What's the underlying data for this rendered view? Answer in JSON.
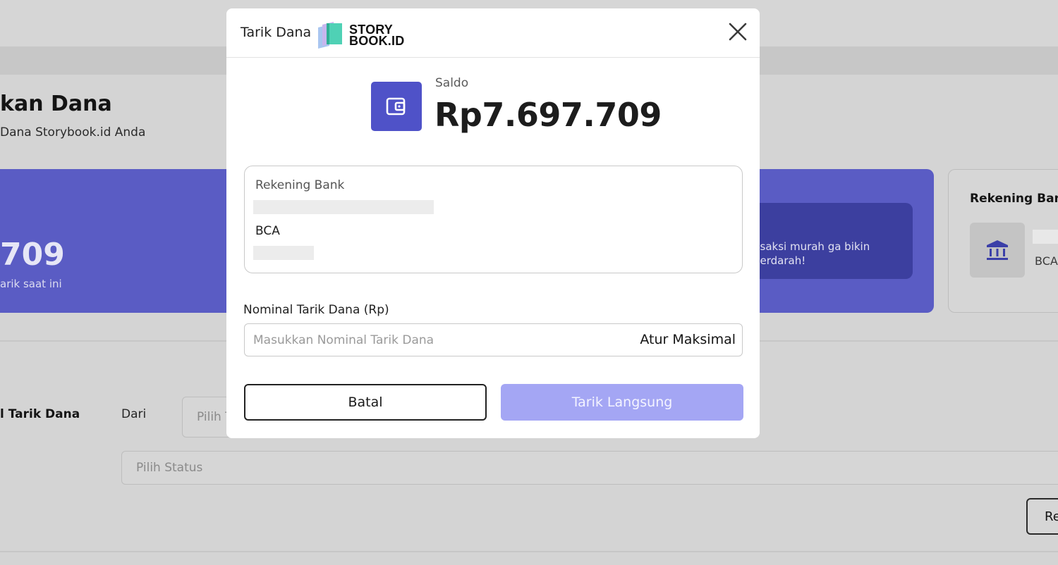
{
  "background": {
    "page_title": "kan Dana",
    "page_subtitle": "Dana Storybook.id Anda",
    "balance_card": {
      "amount": "709",
      "caption": "arik saat ini"
    },
    "promo_card": {
      "text": "nsaksi murah ga bikin berdarah!"
    },
    "bank_card": {
      "title": "Rekening Bank",
      "bank_name": "BCA"
    },
    "filter": {
      "label": "l Tarik Dana",
      "from_label": "Dari",
      "date_placeholder": "Pilih T",
      "status_placeholder": "Pilih Status",
      "reset_label": "Re"
    }
  },
  "modal": {
    "title": "Tarik Dana",
    "brand": {
      "line1": "STORY",
      "line2": "BOOK.ID"
    },
    "saldo_label": "Saldo",
    "saldo_amount": "Rp7.697.709",
    "bank_box": {
      "label": "Rekening Bank",
      "bank_name": "BCA"
    },
    "nominal": {
      "label": "Nominal Tarik Dana (Rp)",
      "placeholder": "Masukkan Nominal Tarik Dana",
      "value": "",
      "max_label": "Atur Maksimal"
    },
    "buttons": {
      "cancel": "Batal",
      "withdraw": "Tarik Langsung"
    }
  },
  "colors": {
    "accent": "#4f52c8",
    "accent_disabled": "#a4a6f4",
    "overlay_card": "#5a5cc4"
  },
  "icons": [
    "storybook-logo-icon",
    "close-icon",
    "wallet-icon",
    "bank-icon"
  ]
}
